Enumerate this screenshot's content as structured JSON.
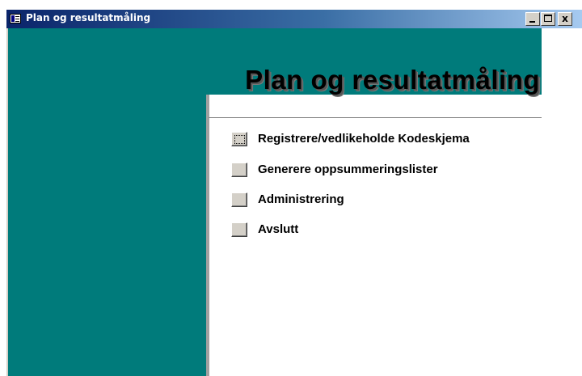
{
  "window": {
    "title": "Plan og resultatmåling",
    "icon": "form-icon",
    "controls": {
      "minimize": "minimize-icon",
      "maximize": "maximize-icon",
      "close_label": "x"
    }
  },
  "form": {
    "heading": "Plan og resultatmåling",
    "colors": {
      "panel": "#007b7b",
      "background": "#ffffff",
      "button_face": "#d4d0c8"
    },
    "menu": [
      {
        "label": "Registrere/vedlikeholde Kodeskjema",
        "focused": true
      },
      {
        "label": "Generere oppsummeringslister",
        "focused": false
      },
      {
        "label": "Administrering",
        "focused": false
      },
      {
        "label": "Avslutt",
        "focused": false
      }
    ]
  }
}
